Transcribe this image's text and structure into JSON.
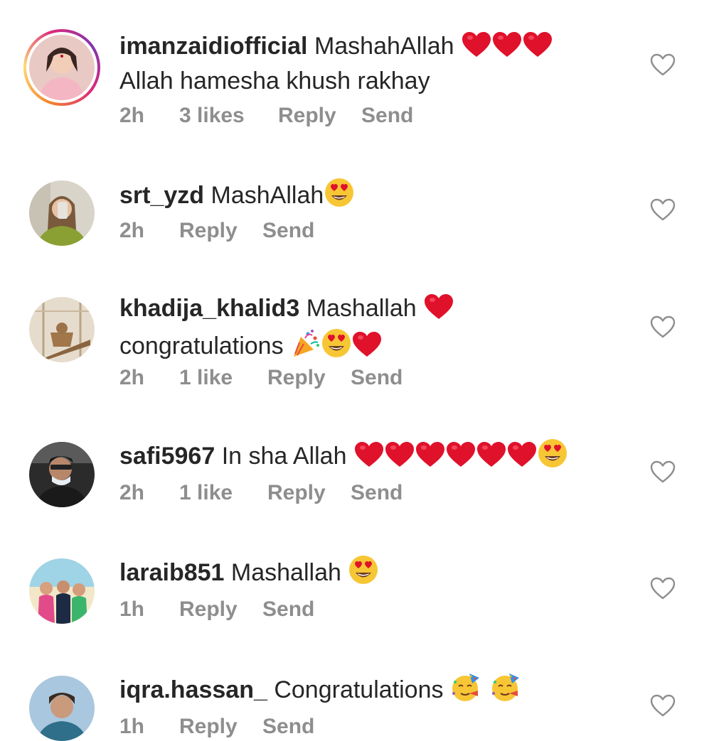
{
  "comments": [
    {
      "username": "imanzaidiofficial",
      "text_line1": "MashahAllah",
      "text_line2": "Allah hamesha khush rakhay",
      "time": "2h",
      "likes": "3 likes",
      "reply": "Reply",
      "send": "Send",
      "has_story_ring": true,
      "emojis": [
        "red-heart-emoji",
        "red-heart-emoji",
        "red-heart-emoji"
      ]
    },
    {
      "username": "srt_yzd",
      "text_line1": "MashAllah",
      "time": "2h",
      "reply": "Reply",
      "send": "Send",
      "emojis": [
        "heart-eyes-emoji"
      ]
    },
    {
      "username": "khadija_khalid3",
      "text_line1": "Mashallah",
      "text_line2": "congratulations",
      "time": "2h",
      "likes": "1 like",
      "reply": "Reply",
      "send": "Send",
      "emojis": [
        "red-heart-emoji",
        "party-popper-emoji",
        "heart-eyes-emoji",
        "red-heart-emoji"
      ]
    },
    {
      "username": "safi5967",
      "text_line1": "In sha Allah",
      "time": "2h",
      "likes": "1 like",
      "reply": "Reply",
      "send": "Send",
      "emojis": [
        "red-heart-emoji",
        "red-heart-emoji",
        "red-heart-emoji",
        "red-heart-emoji",
        "red-heart-emoji",
        "red-heart-emoji",
        "heart-eyes-emoji"
      ]
    },
    {
      "username": "laraib851",
      "text_line1": "Mashallah",
      "time": "1h",
      "reply": "Reply",
      "send": "Send",
      "emojis": [
        "heart-eyes-emoji"
      ]
    },
    {
      "username": "iqra.hassan_",
      "text_line1": "Congratulations",
      "time": "1h",
      "reply": "Reply",
      "send": "Send",
      "emojis": [
        "partying-face-emoji",
        "partying-face-emoji"
      ]
    }
  ],
  "icons": {
    "like": "heart-outline-icon"
  },
  "colors": {
    "text": "#262626",
    "meta": "#8e8e8e",
    "heart_emoji": "#e0112b",
    "emoji_face": "#f7c634"
  }
}
